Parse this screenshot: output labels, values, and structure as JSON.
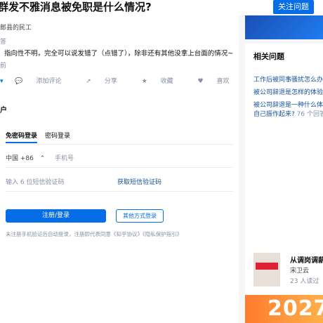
{
  "header": {
    "question_title": "群发不雅消息被免职是什么情况?",
    "follow_label": "关注问题"
  },
  "answer": {
    "author": "郎县的民工",
    "signature": "答",
    "text": "指向性不明，完全可以说发错了（点错了），除非还有其他没拿上台面的情况~",
    "edited": "前",
    "actions": {
      "comment": "添加评论",
      "share": "分享",
      "favorite": "收藏",
      "like": "喜欢"
    },
    "section_label": "户"
  },
  "sidebar": {
    "related_title": "相关问题",
    "related": [
      {
        "text": "工作后被同事骚扰怎么办?"
      },
      {
        "text": "被公司辞退是怎样的体验?"
      },
      {
        "text": "被公司辞退是一种什么体验"
      },
      {
        "text": "自己振作起来?",
        "meta": "76 个回答"
      }
    ],
    "cards": [
      {
        "title": "从调岗调薪到",
        "author": "宋卫云",
        "reads": "23 人读过"
      }
    ],
    "banner_text": "2027"
  },
  "login": {
    "tabs": [
      "免密码登录",
      "密码登录"
    ],
    "country_code": "中国 +86",
    "phone_placeholder": "手机号",
    "code_placeholder": "输入 6 位短信验证码",
    "get_code": "获取短信验证码",
    "submit": "注册/登录",
    "other": "其他方式登录",
    "terms": "未注册手机验证后自动登录，注册即代表同意《知乎协议》《隐私保护指引》"
  },
  "colors": {
    "accent": "#056de8",
    "link": "#175199"
  }
}
